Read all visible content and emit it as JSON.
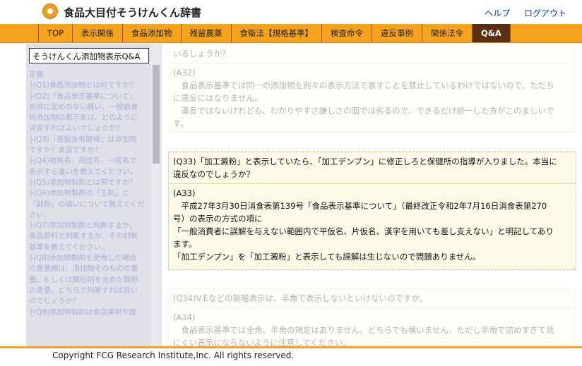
{
  "header": {
    "site_title": "食品大目付そうけんくん辞書",
    "help": "ヘルプ",
    "logout": "ログアウト"
  },
  "nav": {
    "items": [
      "TOP",
      "表示関係",
      "食品添加物",
      "残留農薬",
      "食衛法【規格基準】",
      "検査命令",
      "違反事例",
      "関係法令",
      "Q&A"
    ],
    "active": "Q&A"
  },
  "sidebar": {
    "title": "そうけんくん添加物表示Q&A",
    "items": [
      "定義",
      "├(Q1)食品添加物とは何ですか？",
      "├(Q2)「食品表示基準について」",
      "別添に定めのない無い、一般飲食",
      "物添加物の表示名は、どのように",
      "決定すればよいでしょうか？",
      "├(Q3)「亜鉛含有酵母」は添加物",
      "ですか？食品ですか？",
      "├(Q4)物質名、用途名、一括名で",
      "表示する違いを教えてください。",
      "├(Q5)添加物製剤とは何ですか？",
      "├(Q6)添加物製剤の「主剤」と",
      "「副剤」の違いについて教えてくだ",
      "さい。",
      "├(Q7)添加物製剤と判断するか、",
      "食品原料と判断するか、その判断",
      "基準を教えてください。",
      "├(Q8)添加物製剤を使用した場合",
      "の重量順は、添加物そのものの重",
      "量、もしくは賦形剤を含めた製剤",
      "の重量、どちらで判断すれば良い",
      "のでしょうか？",
      "├(Q9)添加物製剤は食品素材や既"
    ]
  },
  "content": {
    "prev_q_tail": "いるしょうか？",
    "a32_label": "(A32)",
    "a32_text1": "　食品表示基準では同一の添加物を別々の表示方法で表すことを禁止しているわけではないので、ただち",
    "a32_text2": "に違反にはなりません。",
    "a32_text3": "　違反ではないけれども、わかりやすさ謙しさの面では劣るので、できるだけ統一した方がこのましいで",
    "a32_text4": "す。",
    "q33_line1": "(Q33)「加工澱粉」と表示していたら、「加工デンプン」に修正しろと保健所の指導が入りました。本当に",
    "q33_line2": "違反なのでしょうか？",
    "a33_label": "(A33)",
    "a33_text1": "　平成27年3月30日消食表第139号「食品表示基準について」（最終改正令和2年7月16日消食表第270",
    "a33_text2": "号）の表示の方式の項に",
    "a33_text3": "「一般消費者に誤解を与えない範囲内で平仮名、片仮名、漢字を用いても差し支えない」と明記してあり",
    "a33_text4": "ます。",
    "a33_text5": "「加工デンプン」を「加工澱粉」と表示しても誤解は生じないので問題ありません。",
    "q34_line1": "(Q34)V.Eなどの簡略表示は、半角で表示しないといけないのですか。",
    "a34_label": "(A34)",
    "a34_text1": "　食品表示基準では全角、半角の規定はありません。どちらでも構いません。ただし半角で詰めすぎて見",
    "a34_text2": "にくい表示にならないように注意してください。"
  },
  "footer": {
    "copyright": "Copyright FCG Research Institute,Inc. All rights reserved."
  }
}
